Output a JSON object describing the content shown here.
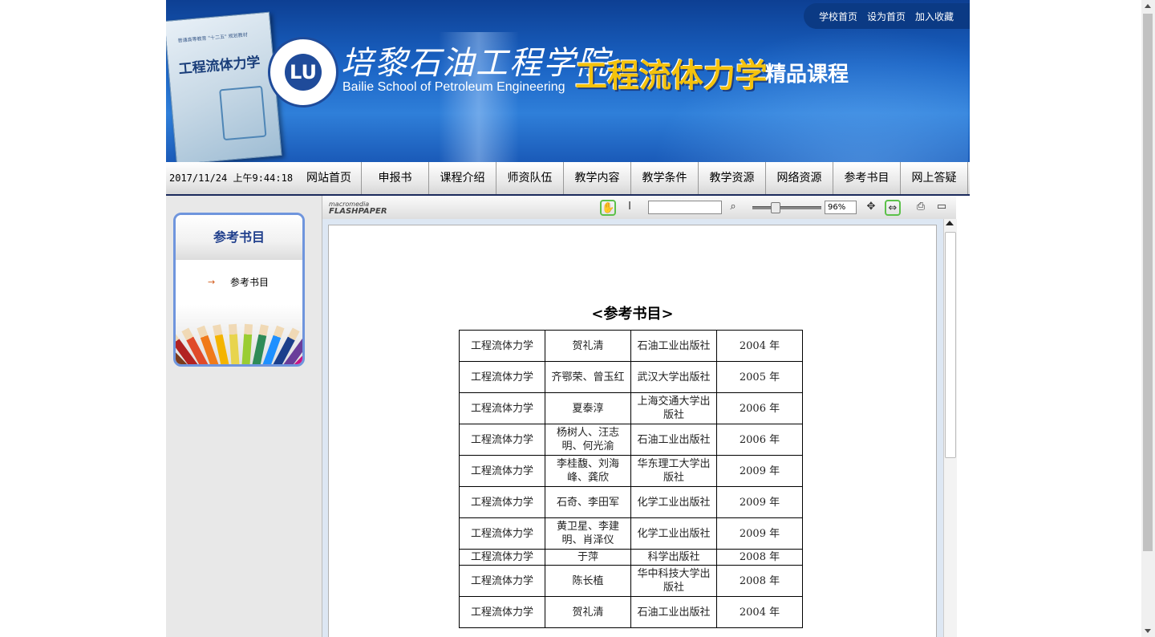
{
  "header": {
    "book_title": "工程流体力学",
    "school_cn": "培黎石油工程学院",
    "school_en": "Bailie School of Petroleum Engineering",
    "course_title": "工程流体力学",
    "course_sub": "精品课程",
    "top_links": [
      "学校首页",
      "设为首页",
      "加入收藏"
    ]
  },
  "nav": {
    "datetime": "2017/11/24 上午9:44:18",
    "items": [
      "网站首页",
      "申报书",
      "课程介绍",
      "师资队伍",
      "教学内容",
      "教学条件",
      "教学资源",
      "网络资源",
      "参考书目",
      "网上答疑"
    ]
  },
  "sidebar": {
    "title": "参考书目",
    "link": "参考书目",
    "arrow_icon": "→"
  },
  "viewer": {
    "logo_top": "macromedia",
    "logo_bottom": "FLASHPAPER",
    "zoom": "96%",
    "search_value": ""
  },
  "document": {
    "heading": "<参考书目>",
    "rows": [
      [
        "工程流体力学",
        "贺礼清",
        "石油工业出版社",
        "2004 年"
      ],
      [
        "工程流体力学",
        "齐鄂荣、曾玉红",
        "武汉大学出版社",
        "2005 年"
      ],
      [
        "工程流体力学",
        "夏泰淳",
        "上海交通大学出版社",
        "2006 年"
      ],
      [
        "工程流体力学",
        "杨树人、汪志明、何光渝",
        "石油工业出版社",
        "2006 年"
      ],
      [
        "工程流体力学",
        "李桂馥、刘海峰、龚欣",
        "华东理工大学出版社",
        "2009 年"
      ],
      [
        "工程流体力学",
        "石奇、李田军",
        "化学工业出版社",
        "2009 年"
      ],
      [
        "工程流体力学",
        "黄卫星、李建明、肖泽仪",
        "化学工业出版社",
        "2009 年"
      ],
      [
        "工程流体力学",
        "于萍",
        "科学出版社",
        "2008 年"
      ],
      [
        "工程流体力学",
        "陈长植",
        "华中科技大学出版社",
        "2008 年"
      ],
      [
        "工程流体力学",
        "贺礼清",
        "石油工业出版社",
        "2004 年"
      ]
    ]
  }
}
